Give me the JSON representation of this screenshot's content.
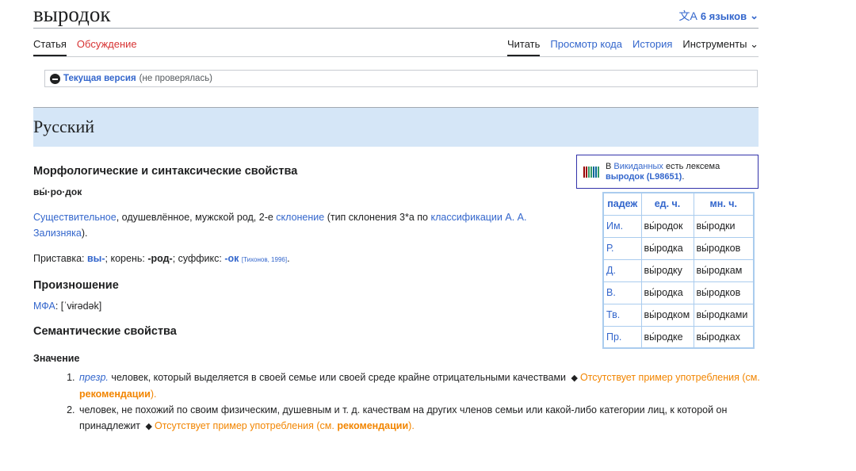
{
  "header": {
    "title": "выродок",
    "languages_label": "6 языков",
    "languages_icon": "translate-icon"
  },
  "tabs": {
    "left": [
      "Статья",
      "Обсуждение"
    ],
    "right": [
      "Читать",
      "Просмотр кода",
      "История",
      "Инструменты"
    ]
  },
  "flagged": {
    "current": "Текущая версия",
    "note": "(не проверялась)"
  },
  "language_section": "Русский",
  "morph": {
    "heading": "Морфологические и синтаксические свойства",
    "hyphenation": "вы́·ро·док",
    "desc_link1": "Существительное",
    "desc_text1": ", одушевлённое, мужской род, 2-е ",
    "desc_link2": "склонение",
    "desc_text2": " (тип склонения 3*a по ",
    "desc_link3": "классификации А. А. Зализняка",
    "desc_text3": ").",
    "prefix_label": "Приставка: ",
    "prefix": "вы-",
    "root_label": "; корень: ",
    "root": "-род-",
    "suffix_label": "; суффикс: ",
    "suffix": "-ок",
    "ref": "[Тихонов, 1996]",
    "end": "."
  },
  "pron": {
    "heading": "Произношение",
    "ipa_label": "МФА",
    "ipa": ": [ˈvɨrədək]"
  },
  "semantic": {
    "heading": "Семантические свойства",
    "meaning_heading": "Значение",
    "items": [
      {
        "label": "презр.",
        "text": " человек, который выделяется в своей семье или своей среде крайне отрицательными качествами ",
        "missing": "Отсутствует пример употребления (см. ",
        "rec": "рекомендации",
        "close": ")."
      },
      {
        "label": "",
        "text": "человек, не похожий по своим физическим, душевным и т. д. качествам на других членов семьи или какой-либо категории лиц, к которой он принадлежит ",
        "missing": "Отсутствует пример употребления (см. ",
        "rec": "рекомендации",
        "close": ")."
      }
    ]
  },
  "wikidata": {
    "prefix": "В ",
    "link": "Викиданных",
    "mid": " есть лексема ",
    "lexeme": "выродок (L98651)",
    "end": "."
  },
  "declension": {
    "headers": [
      "падеж",
      "ед. ч.",
      "мн. ч."
    ],
    "rows": [
      [
        "Им.",
        "вы́родок",
        "вы́родки"
      ],
      [
        "Р.",
        "вы́родка",
        "вы́родков"
      ],
      [
        "Д.",
        "вы́родку",
        "вы́родкам"
      ],
      [
        "В.",
        "вы́родка",
        "вы́родков"
      ],
      [
        "Тв.",
        "вы́родком",
        "вы́родками"
      ],
      [
        "Пр.",
        "вы́родке",
        "вы́родках"
      ]
    ]
  },
  "colors": {
    "link": "#3366cc",
    "red_link": "#d73333",
    "orange": "#f28500",
    "heading_bg": "#d5e6f7"
  }
}
